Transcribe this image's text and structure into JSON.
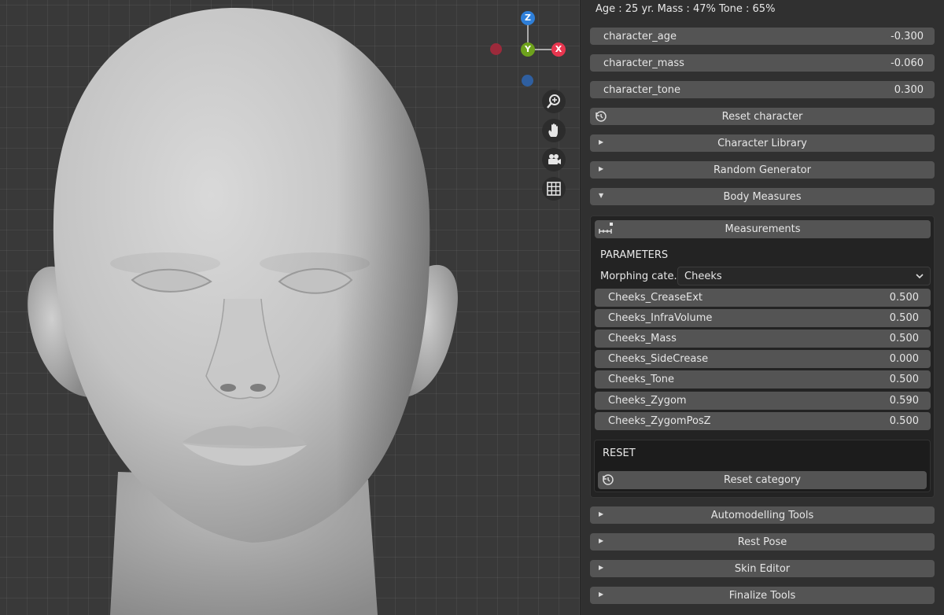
{
  "viewport": {
    "gizmo": {
      "z_label": "Z",
      "y_label": "Y",
      "x_label": "X",
      "colors": {
        "z": "#2e7fd9",
        "y": "#6ea21c",
        "x": "#e8364f",
        "neg_x": "#9c2a3b",
        "neg_z": "#2f5fa0"
      }
    },
    "nav_icons": [
      "zoom-icon",
      "hand-pan-icon",
      "camera-icon",
      "grid-icon"
    ]
  },
  "sidebar": {
    "info_line": "Age : 25 yr.  Mass : 47%  Tone : 65%",
    "props": [
      {
        "label": "character_age",
        "value": "-0.300"
      },
      {
        "label": "character_mass",
        "value": "-0.060"
      },
      {
        "label": "character_tone",
        "value": "0.300"
      }
    ],
    "reset_character": "Reset character",
    "character_library": "Character Library",
    "random_generator": "Random Generator",
    "body_measures": "Body Measures",
    "measurements": "Measurements",
    "parameters_title": "PARAMETERS",
    "morph_label": "Morphing cate..",
    "morph_value": "Cheeks",
    "sliders": [
      {
        "label": "Cheeks_CreaseExt",
        "value": "0.500"
      },
      {
        "label": "Cheeks_InfraVolume",
        "value": "0.500"
      },
      {
        "label": "Cheeks_Mass",
        "value": "0.500"
      },
      {
        "label": "Cheeks_SideCrease",
        "value": "0.000"
      },
      {
        "label": "Cheeks_Tone",
        "value": "0.500"
      },
      {
        "label": "Cheeks_Zygom",
        "value": "0.590"
      },
      {
        "label": "Cheeks_ZygomPosZ",
        "value": "0.500"
      }
    ],
    "reset_title": "RESET",
    "reset_category": "Reset category",
    "automodelling_tools": "Automodelling Tools",
    "rest_pose": "Rest Pose",
    "skin_editor": "Skin Editor",
    "finalize_tools": "Finalize Tools"
  }
}
